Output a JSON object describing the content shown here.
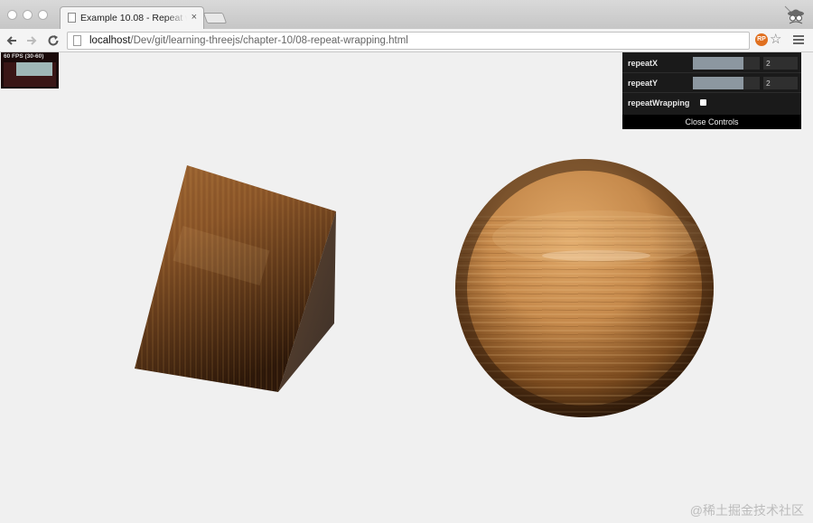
{
  "window": {
    "tab_title": "Example 10.08 - Repeat w",
    "tab_close": "×"
  },
  "toolbar": {
    "url_host": "localhost",
    "url_path": "/Dev/git/learning-threejs/chapter-10/08-repeat-wrapping.html",
    "ext_badge": "RP"
  },
  "stats": {
    "fps_text": "60 FPS (30-60)"
  },
  "controls": {
    "repeatX": {
      "label": "repeatX",
      "value": "2",
      "fraction": 0.75
    },
    "repeatY": {
      "label": "repeatY",
      "value": "2",
      "fraction": 0.75
    },
    "repeatWrapping": {
      "label": "repeatWrapping",
      "checked": false
    },
    "close_label": "Close Controls"
  },
  "scene": {
    "objects": [
      "wood-textured-cube",
      "wood-textured-sphere"
    ],
    "background": "#f0f0f0",
    "wood_light": "#d89a5a",
    "wood_dark": "#2a1608"
  },
  "watermark": "@稀土掘金技术社区"
}
